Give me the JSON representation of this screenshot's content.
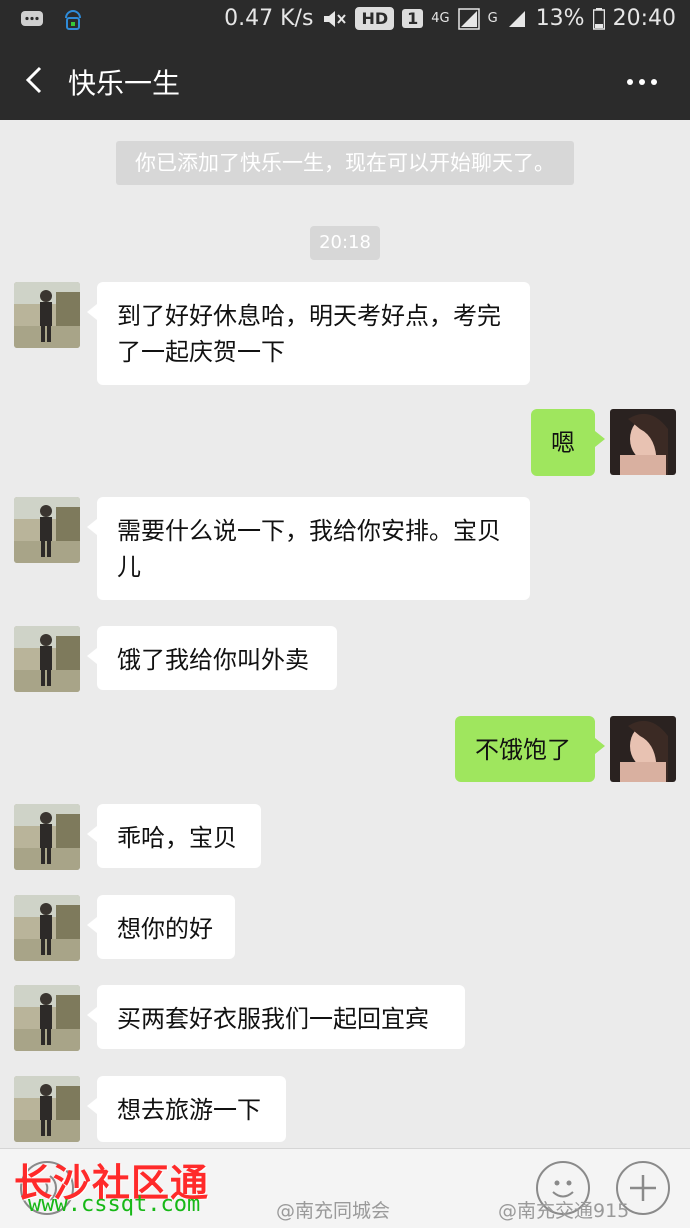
{
  "status_bar": {
    "net_speed": "0.47 K/s",
    "hd": "HD",
    "sim": "1",
    "net_4g": "4G",
    "net_g": "G",
    "battery": "13%",
    "time": "20:40"
  },
  "header": {
    "title": "快乐一生"
  },
  "system_note": "你已添加了快乐一生，现在可以开始聊天了。",
  "timestamp": "20:18",
  "messages": [
    {
      "side": "in",
      "lines": [
        "到了好好休息哈，明天考好点，考完",
        "了一起庆贺一下"
      ]
    },
    {
      "side": "out",
      "lines": [
        "嗯"
      ]
    },
    {
      "side": "in",
      "lines": [
        "需要什么说一下，我给你安排。宝贝",
        "儿"
      ]
    },
    {
      "side": "in",
      "lines": [
        "饿了我给你叫外卖"
      ]
    },
    {
      "side": "out",
      "lines": [
        "不饿饱了"
      ]
    },
    {
      "side": "in",
      "lines": [
        "乖哈，宝贝"
      ]
    },
    {
      "side": "in",
      "lines": [
        "想你的好"
      ]
    },
    {
      "side": "in",
      "lines": [
        "买两套好衣服我们一起回宜宾"
      ]
    },
    {
      "side": "in",
      "lines": [
        "想去旅游一下"
      ]
    }
  ],
  "watermarks": {
    "logo": "长沙社区通",
    "url": "www.cssqt.com",
    "weibo_left": "@南充同城会",
    "weibo_right": "@南充交通915"
  },
  "colors": {
    "header_bg": "#2b2b2b",
    "chat_bg": "#ebebeb",
    "incoming_bubble": "#ffffff",
    "outgoing_bubble": "#9fe65e"
  }
}
